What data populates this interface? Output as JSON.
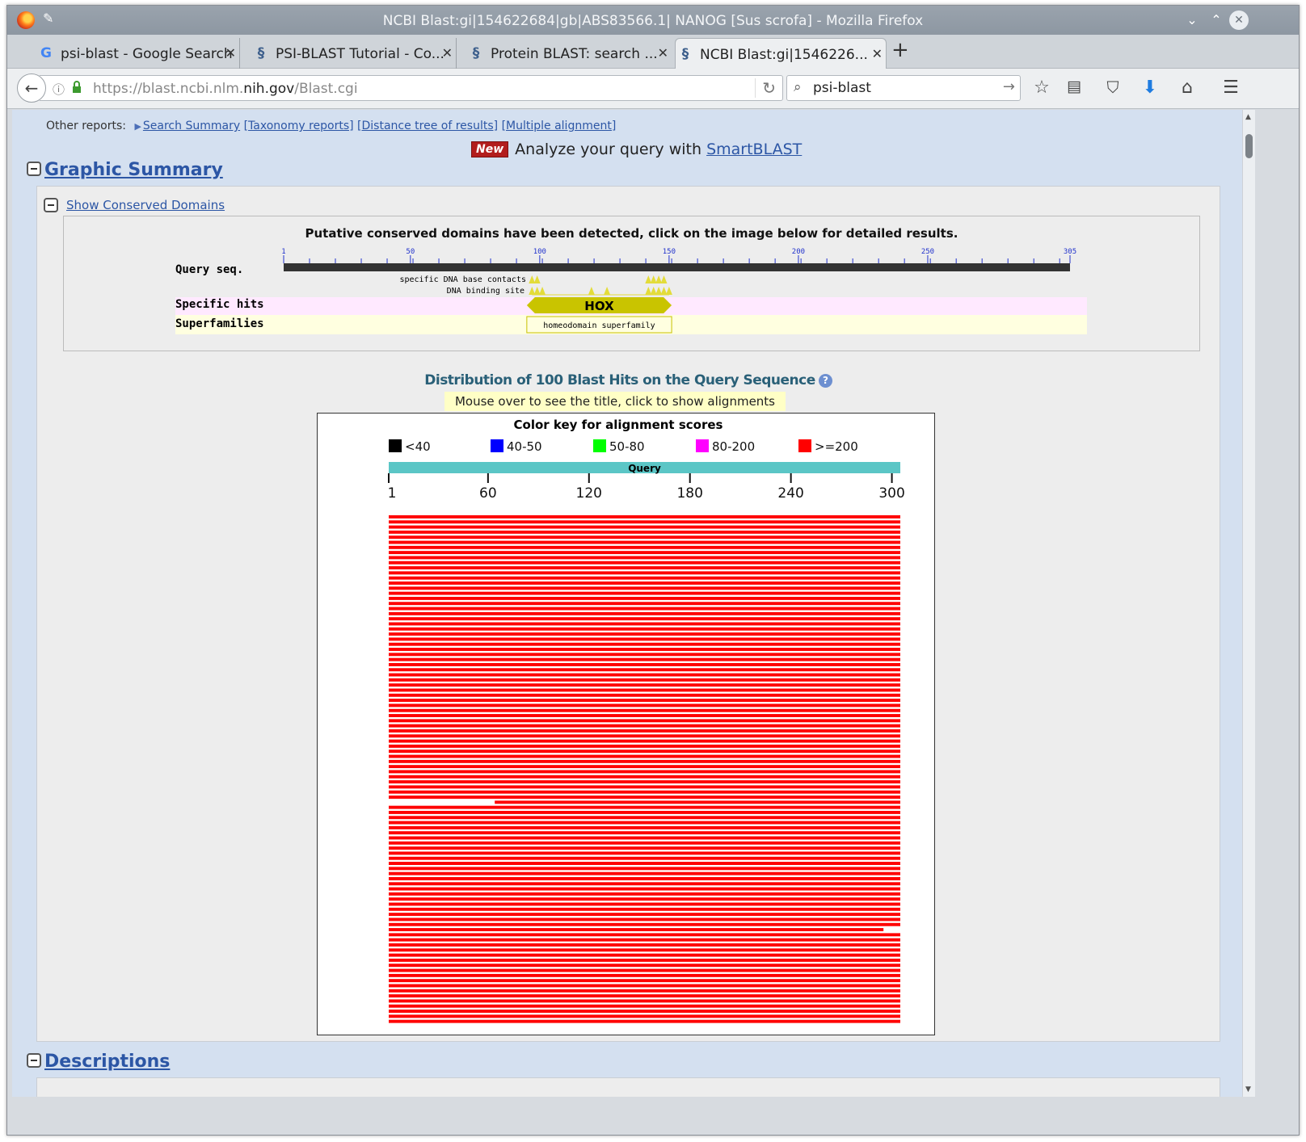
{
  "window": {
    "title": "NCBI Blast:gi|154622684|gb|ABS83566.1| NANOG [Sus scrofa] - Mozilla Firefox"
  },
  "tabs": [
    {
      "label": "psi-blast - Google Search",
      "icon": "google-icon",
      "close": "✕"
    },
    {
      "label": "PSI-BLAST Tutorial - Co...",
      "icon": "ncbi-helix-icon",
      "close": "✕"
    },
    {
      "label": "Protein BLAST: search ...",
      "icon": "ncbi-helix-icon",
      "close": "✕"
    },
    {
      "label": "NCBI Blast:gi|1546226...",
      "icon": "ncbi-helix-icon",
      "close": "✕"
    }
  ],
  "nav": {
    "url_prefix": "https://blast.ncbi.nlm.",
    "url_domain": "nih.gov",
    "url_suffix": "/Blast.cgi",
    "search_value": "psi-blast"
  },
  "page": {
    "other_reports_label": "Other reports:",
    "reports": [
      "Search Summary",
      "[Taxonomy reports]",
      "[Distance tree of results]",
      "[Multiple alignment]"
    ],
    "new_badge": "New",
    "smartblast_text": "Analyze your query with",
    "smartblast_link": "SmartBLAST",
    "graphic_summary": "Graphic Summary",
    "show_conserved_domains": "Show Conserved Domains",
    "cdd_message": "Putative conserved domains have been detected, click on the image below for detailed results.",
    "cdd": {
      "query_len": 305,
      "ticks": [
        1,
        50,
        100,
        150,
        200,
        250,
        305
      ],
      "query_label": "Query seq.",
      "specific_hits_label": "Specific hits",
      "superfamilies_label": "Superfamilies",
      "dna_contacts_label": "specific DNA base contacts",
      "dna_binding_label": "DNA binding site",
      "domain_name": "HOX",
      "domain_start": 95,
      "domain_end": 151,
      "superfamily_name": "homeodomain superfamily",
      "contact_sites": [
        97,
        99,
        142,
        144,
        146,
        148
      ],
      "binding_sites": [
        97,
        99,
        101,
        120,
        126,
        142,
        144,
        146,
        148,
        150
      ],
      "colors": {
        "domain": "#c9c400",
        "superfamily_bg": "#ffffe0",
        "hits_bg": "#ffe9ff",
        "sites": "#e3dc3a"
      }
    },
    "dist_title": "Distribution of 100 Blast Hits on the Query Sequence",
    "mouse_hint": "Mouse over to see the title, click to show alignments",
    "color_key_title": "Color key for alignment scores",
    "color_key": [
      {
        "label": "<40",
        "color": "#000000"
      },
      {
        "label": "40-50",
        "color": "#0000ff"
      },
      {
        "label": "50-80",
        "color": "#00ff00"
      },
      {
        "label": "80-200",
        "color": "#ff00ff"
      },
      {
        "label": ">=200",
        "color": "#ff0000"
      }
    ],
    "query_bar_label": "Query",
    "query_bar_color": "#5bc6c6",
    "descriptions": "Descriptions"
  },
  "chart_data": {
    "type": "bar",
    "query_range": [
      1,
      305
    ],
    "axis_ticks": [
      1,
      60,
      120,
      180,
      240,
      300
    ],
    "hits": [
      [
        1,
        305
      ],
      [
        1,
        305
      ],
      [
        1,
        305
      ],
      [
        1,
        305
      ],
      [
        1,
        305
      ],
      [
        1,
        305
      ],
      [
        1,
        305
      ],
      [
        1,
        305
      ],
      [
        1,
        305
      ],
      [
        1,
        305
      ],
      [
        1,
        305
      ],
      [
        1,
        305
      ],
      [
        1,
        305
      ],
      [
        1,
        305
      ],
      [
        1,
        305
      ],
      [
        1,
        305
      ],
      [
        1,
        305
      ],
      [
        1,
        305
      ],
      [
        1,
        305
      ],
      [
        1,
        305
      ],
      [
        1,
        305
      ],
      [
        1,
        305
      ],
      [
        1,
        305
      ],
      [
        1,
        305
      ],
      [
        1,
        305
      ],
      [
        1,
        305
      ],
      [
        1,
        305
      ],
      [
        1,
        305
      ],
      [
        1,
        305
      ],
      [
        1,
        305
      ],
      [
        1,
        305
      ],
      [
        1,
        305
      ],
      [
        1,
        305
      ],
      [
        1,
        305
      ],
      [
        1,
        305
      ],
      [
        1,
        305
      ],
      [
        1,
        305
      ],
      [
        1,
        305
      ],
      [
        1,
        305
      ],
      [
        1,
        305
      ],
      [
        1,
        305
      ],
      [
        1,
        305
      ],
      [
        1,
        305
      ],
      [
        1,
        305
      ],
      [
        1,
        305
      ],
      [
        1,
        305
      ],
      [
        1,
        305
      ],
      [
        1,
        305
      ],
      [
        1,
        305
      ],
      [
        1,
        305
      ],
      [
        1,
        305
      ],
      [
        1,
        305
      ],
      [
        1,
        305
      ],
      [
        1,
        305
      ],
      [
        1,
        305
      ],
      [
        1,
        305
      ],
      [
        64,
        305
      ],
      [
        1,
        305
      ],
      [
        1,
        305
      ],
      [
        1,
        305
      ],
      [
        1,
        305
      ],
      [
        1,
        305
      ],
      [
        1,
        305
      ],
      [
        1,
        305
      ],
      [
        1,
        305
      ],
      [
        1,
        305
      ],
      [
        1,
        305
      ],
      [
        1,
        305
      ],
      [
        1,
        305
      ],
      [
        1,
        305
      ],
      [
        1,
        305
      ],
      [
        1,
        305
      ],
      [
        1,
        305
      ],
      [
        1,
        305
      ],
      [
        1,
        305
      ],
      [
        1,
        305
      ],
      [
        1,
        305
      ],
      [
        1,
        305
      ],
      [
        1,
        305
      ],
      [
        1,
        305
      ],
      [
        1,
        305
      ],
      [
        1,
        295
      ],
      [
        1,
        305
      ],
      [
        1,
        305
      ],
      [
        1,
        305
      ],
      [
        1,
        305
      ],
      [
        1,
        305
      ],
      [
        1,
        305
      ],
      [
        1,
        305
      ],
      [
        1,
        305
      ],
      [
        1,
        305
      ],
      [
        1,
        305
      ],
      [
        1,
        305
      ],
      [
        1,
        305
      ],
      [
        1,
        305
      ],
      [
        1,
        305
      ],
      [
        1,
        305
      ],
      [
        1,
        305
      ],
      [
        1,
        305
      ],
      [
        1,
        305
      ]
    ],
    "score_class": ">=200"
  }
}
